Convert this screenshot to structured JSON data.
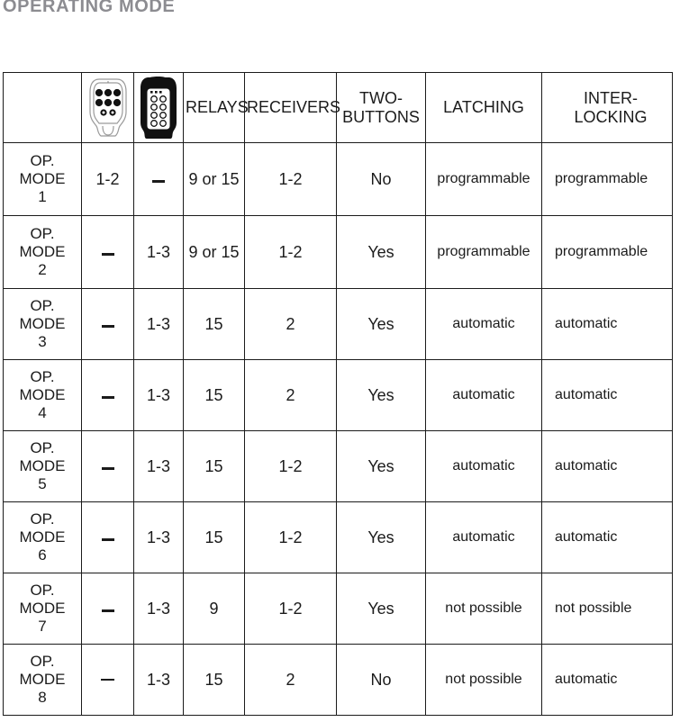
{
  "page": {
    "title": "OPERATING MODE"
  },
  "table": {
    "headers": {
      "mode": "",
      "remote_outline": "remote-outline-icon",
      "remote_filled": "remote-filled-icon",
      "relays": "RELAYS",
      "receivers": "RECEIVERS",
      "two_buttons": "TWO-\nBUTTONS",
      "two_buttons_line1": "TWO-",
      "two_buttons_line2": "BUTTONS",
      "latching": "LATCHING",
      "interlocking_line1": "INTER-",
      "interlocking_line2": "LOCKING"
    },
    "rows": [
      {
        "mode_line1": "OP.",
        "mode_line2": "MODE",
        "mode_line3": "1",
        "remote_outline": "1-2",
        "remote_filled": "—",
        "relays": "9 or 15",
        "receivers": "1-2",
        "two_buttons": "No",
        "latching": "programmable",
        "interlocking": "programmable"
      },
      {
        "mode_line1": "OP.",
        "mode_line2": "MODE",
        "mode_line3": "2",
        "remote_outline": "—",
        "remote_filled": "1-3",
        "relays": "9 or 15",
        "receivers": "1-2",
        "two_buttons": "Yes",
        "latching": "programmable",
        "interlocking": "programmable"
      },
      {
        "mode_line1": "OP.",
        "mode_line2": "MODE",
        "mode_line3": "3",
        "remote_outline": "—",
        "remote_filled": "1-3",
        "relays": "15",
        "receivers": "2",
        "two_buttons": "Yes",
        "latching": "automatic",
        "interlocking": "automatic"
      },
      {
        "mode_line1": "OP.",
        "mode_line2": "MODE",
        "mode_line3": "4",
        "remote_outline": "—",
        "remote_filled": "1-3",
        "relays": "15",
        "receivers": "2",
        "two_buttons": "Yes",
        "latching": "automatic",
        "interlocking": "automatic"
      },
      {
        "mode_line1": "OP.",
        "mode_line2": "MODE",
        "mode_line3": "5",
        "remote_outline": "—",
        "remote_filled": "1-3",
        "relays": "15",
        "receivers": "1-2",
        "two_buttons": "Yes",
        "latching": "automatic",
        "interlocking": "automatic"
      },
      {
        "mode_line1": "OP.",
        "mode_line2": "MODE",
        "mode_line3": "6",
        "remote_outline": "—",
        "remote_filled": "1-3",
        "relays": "15",
        "receivers": "1-2",
        "two_buttons": "Yes",
        "latching": "automatic",
        "interlocking": "automatic"
      },
      {
        "mode_line1": "OP.",
        "mode_line2": "MODE",
        "mode_line3": "7",
        "remote_outline": "—",
        "remote_filled": "1-3",
        "relays": "9",
        "receivers": "1-2",
        "two_buttons": "Yes",
        "latching": "not possible",
        "interlocking": "not possible"
      },
      {
        "mode_line1": "OP.",
        "mode_line2": "MODE",
        "mode_line3": "8",
        "remote_outline": "—",
        "remote_filled": "1-3",
        "relays": "15",
        "receivers": "2",
        "two_buttons": "No",
        "latching": "not possible",
        "interlocking": "automatic"
      }
    ]
  },
  "colors": {
    "title": "#8c8c91",
    "text": "#1b1b1b",
    "border": "#1b1b1b",
    "background": "#ffffff"
  }
}
